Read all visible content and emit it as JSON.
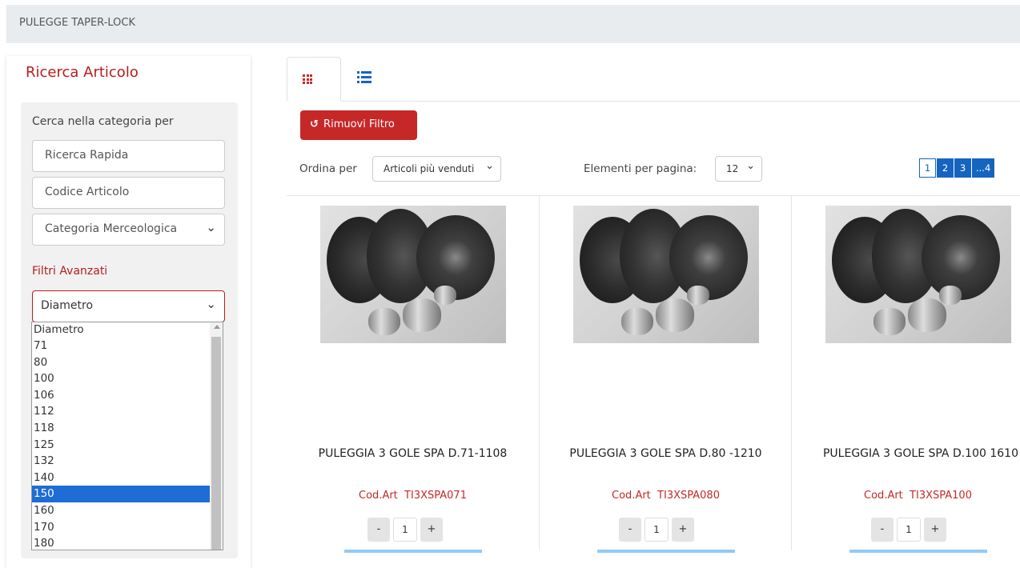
{
  "breadcrumb": "PULEGGE TAPER-LOCK",
  "sidebar": {
    "title": "Ricerca Articolo",
    "search_label": "Cerca nella categoria per",
    "quick_search_placeholder": "Ricerca Rapida",
    "code_placeholder": "Codice Articolo",
    "category_select": "Categoria Merceologica",
    "advanced_label": "Filtri Avanzati",
    "diameter_select": "Diametro",
    "diameter_options": [
      "Diametro",
      "71",
      "80",
      "100",
      "106",
      "112",
      "118",
      "125",
      "132",
      "140",
      "150",
      "160",
      "170",
      "180"
    ],
    "diameter_highlighted": "150"
  },
  "toolbar": {
    "grid_view_icon": "grid-icon",
    "list_view_icon": "list-icon",
    "remove_filter_label": "Rimuovi Filtro",
    "sort_label": "Ordina per",
    "sort_value": "Articoli più venduti",
    "per_page_label": "Elementi per pagina:",
    "per_page_value": "12",
    "pages": [
      "1",
      "2",
      "3",
      "...4"
    ],
    "active_page": "1"
  },
  "products": [
    {
      "title": "PULEGGIA 3 GOLE SPA D.71-1108",
      "code_label": "Cod.Art",
      "code": "TI3XSPA071",
      "qty": "1"
    },
    {
      "title": "PULEGGIA 3 GOLE SPA D.80 -1210",
      "code_label": "Cod.Art",
      "code": "TI3XSPA080",
      "qty": "1"
    },
    {
      "title": "PULEGGIA 3 GOLE SPA D.100 1610",
      "code_label": "Cod.Art",
      "code": "TI3XSPA100",
      "qty": "1"
    }
  ],
  "colors": {
    "accent_red": "#c62828",
    "accent_blue": "#1565c0",
    "selected_option": "#1e6cd6"
  }
}
